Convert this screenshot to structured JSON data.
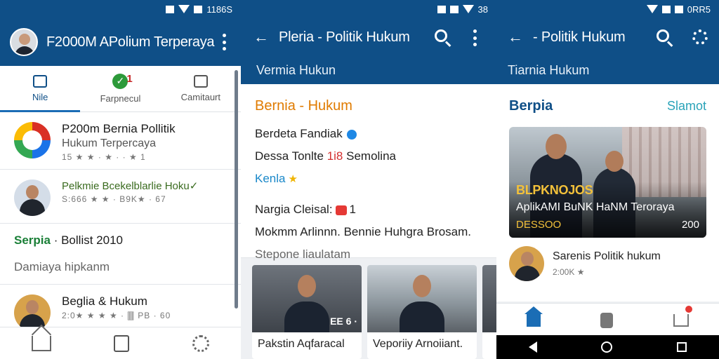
{
  "panel1": {
    "status_time": "1186S",
    "app_title": "F2000M APolium Terperaya",
    "tabs": [
      {
        "label": "Nile",
        "icon": "home-tab-icon"
      },
      {
        "label": "Farpnecul",
        "icon": "check-badge-icon",
        "badge": "1"
      },
      {
        "label": "Camitaurt",
        "icon": "calendar-icon"
      }
    ],
    "items": [
      {
        "title": "P200m Bernia Pollitik",
        "subtitle": "Hukum Terpercaya",
        "meta": "15 ★ ★ · ★ · · ★ 1"
      },
      {
        "title": "Pelkmie Bcekelblarlie Hoku✓",
        "meta": "S:666 ★ ★ · B9K★ · 67"
      }
    ],
    "section": {
      "title_green": "Serpia",
      "title_rest": " · Bollist 2010",
      "sub": "Damiaya hipkanm"
    },
    "item3": {
      "title": "Beglia & Hukum",
      "meta": "2:0★ ★ ★ ★ · 🀫 PB · 60"
    }
  },
  "panel2": {
    "status_time": "38",
    "title": "Pleria - Politik Hukum",
    "subtitle": "Vermia Hukun",
    "article": {
      "head": "Bernia - Hukum",
      "line1": "Berdeta Fandiak",
      "line2_a": "Dessa Tonlte ",
      "line2_red": "1i8",
      "line2_b": " Semolina",
      "link": "Kenla",
      "line3_a": "Nargia Cleisal:",
      "line3_b": "1",
      "line4": "Mokmm Arlinnn. Bennie Huhgra Brosam.",
      "line5": "Stepone liaulatam"
    },
    "news": [
      {
        "caption": "Pakstin Aqfaracal",
        "overlay": "EE 6 ·"
      },
      {
        "caption": "Veporiiy Arnoiiant.",
        "overlay": ""
      }
    ]
  },
  "panel3": {
    "status_time": "0RR5",
    "title": "- Politik Hukum",
    "subtitle": "Tiarnia Hukum",
    "section_title": "Berpia",
    "section_link": "Slamot",
    "hero": {
      "kicker": "BLPKNOJOS",
      "title": "AplikAMI BuNK HaNM Teroraya",
      "left": "DESSOO",
      "right": "200"
    },
    "mini": {
      "title": "Sarenis Politik hukum",
      "meta": "2:00K ★"
    }
  }
}
